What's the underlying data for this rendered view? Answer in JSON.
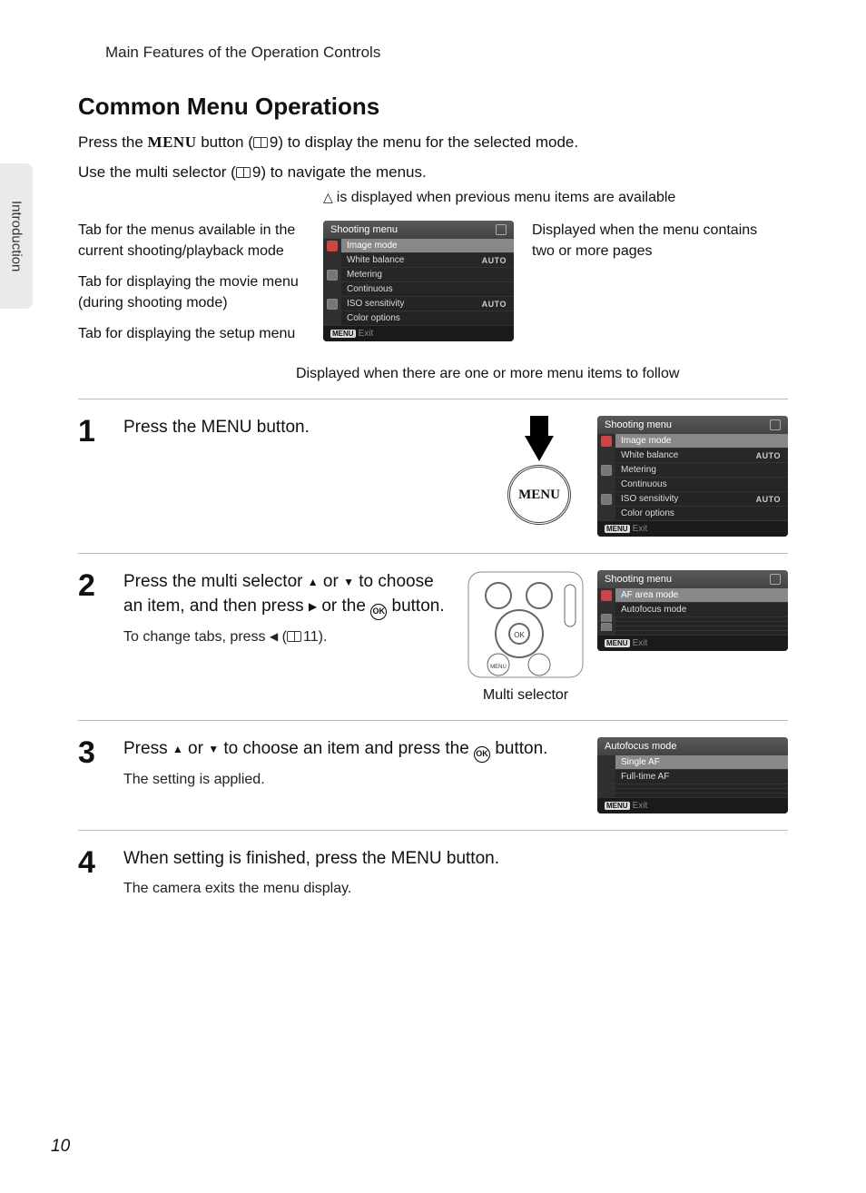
{
  "sideTab": "Introduction",
  "breadcrumb": "Main Features of the Operation Controls",
  "sectionTitle": "Common Menu Operations",
  "intro1_a": "Press the ",
  "intro1_btn": "MENU",
  "intro1_b": " button (",
  "intro1_ref": "9",
  "intro1_c": ") to display the menu for the selected mode.",
  "intro2_a": "Use the multi selector (",
  "intro2_ref": "9",
  "intro2_b": ") to navigate the menus.",
  "annotTop": "is displayed when previous menu items are available",
  "annotLeft1": "Tab for the menus available in the current shooting/playback mode",
  "annotLeft2": "Tab for displaying the movie menu (during shooting mode)",
  "annotLeft3": "Tab for displaying the setup menu",
  "annotRight1": "Displayed when the menu contains two or more pages",
  "annotBottom": "Displayed when there are one or more menu items to follow",
  "menu": {
    "title": "Shooting menu",
    "rows": [
      {
        "label": "Image mode",
        "value": ""
      },
      {
        "label": "White balance",
        "value": "AUTO"
      },
      {
        "label": "Metering",
        "value": ""
      },
      {
        "label": "Continuous",
        "value": ""
      },
      {
        "label": "ISO sensitivity",
        "value": "AUTO"
      },
      {
        "label": "Color options",
        "value": ""
      }
    ],
    "exit": "Exit"
  },
  "step1": {
    "num": "1",
    "title_a": "Press the ",
    "title_btn": "MENU",
    "title_b": " button.",
    "btnLabel": "MENU",
    "menu": {
      "title": "Shooting menu",
      "rows": [
        {
          "label": "Image mode",
          "value": ""
        },
        {
          "label": "White balance",
          "value": "AUTO"
        },
        {
          "label": "Metering",
          "value": ""
        },
        {
          "label": "Continuous",
          "value": ""
        },
        {
          "label": "ISO sensitivity",
          "value": "AUTO"
        },
        {
          "label": "Color options",
          "value": ""
        }
      ],
      "exit": "Exit"
    }
  },
  "step2": {
    "num": "2",
    "title_a": "Press the multi selector ",
    "title_b": " or ",
    "title_c": " to choose an item, and then press ",
    "title_d": " or the ",
    "title_e": " button.",
    "sub_a": "To change tabs, press ",
    "sub_b": " (",
    "sub_ref": "11",
    "sub_c": ").",
    "msLabel": "Multi selector",
    "okLabel": "OK",
    "menu": {
      "title": "Shooting menu",
      "rows": [
        {
          "label": "AF area mode",
          "value": ""
        },
        {
          "label": "Autofocus mode",
          "value": ""
        }
      ],
      "exit": "Exit"
    }
  },
  "step3": {
    "num": "3",
    "title_a": "Press ",
    "title_b": " or ",
    "title_c": " to choose an item and press the ",
    "title_d": " button.",
    "sub": "The setting is applied.",
    "okLabel": "OK",
    "menu": {
      "title": "Autofocus mode",
      "rows": [
        {
          "label": "Single AF",
          "value": ""
        },
        {
          "label": "Full-time AF",
          "value": ""
        }
      ],
      "exit": "Exit"
    }
  },
  "step4": {
    "num": "4",
    "title_a": "When setting is finished, press the ",
    "title_btn": "MENU",
    "title_b": " button.",
    "sub": "The camera exits the menu display."
  },
  "pageNum": "10"
}
